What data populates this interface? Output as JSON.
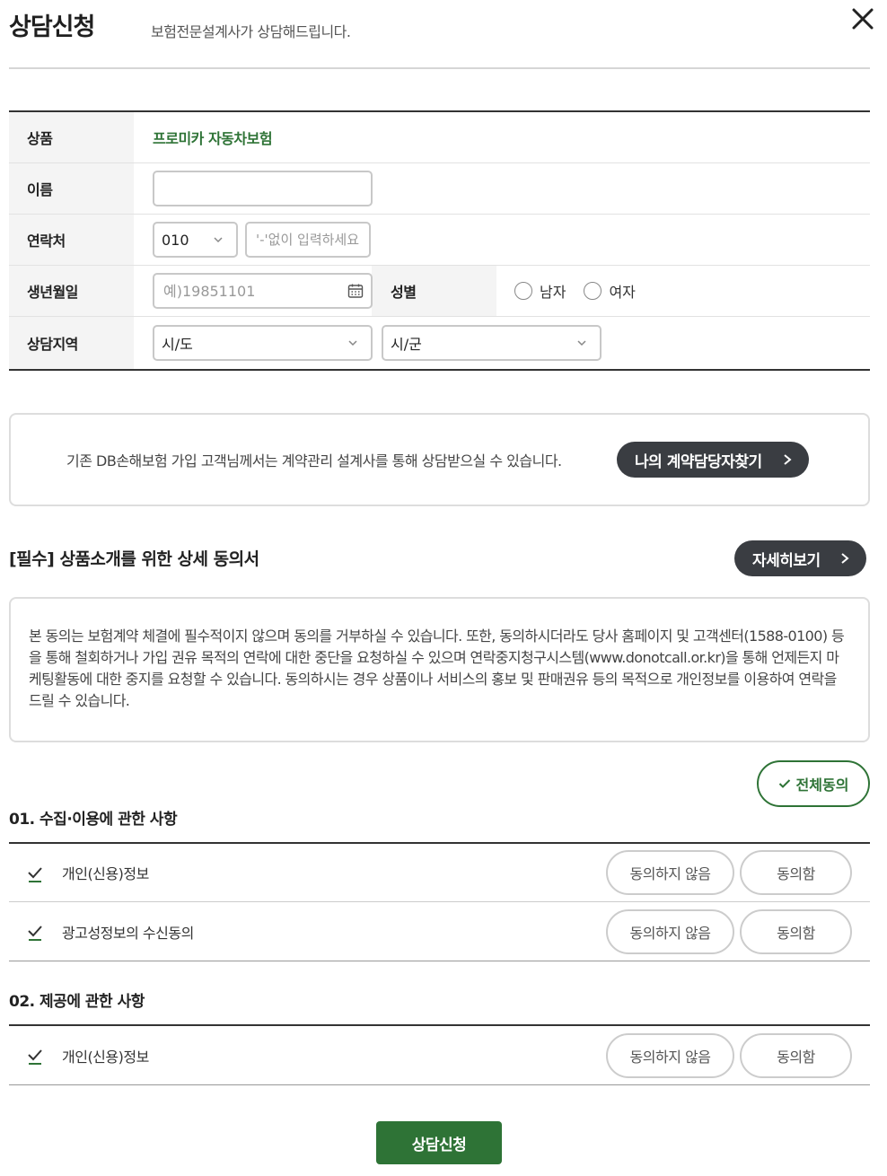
{
  "header": {
    "title": "상담신청",
    "subtitle": "보험전문설계사가 상담해드립니다."
  },
  "form": {
    "product_label": "상품",
    "product_value": "프로미카 자동차보험",
    "name_label": "이름",
    "name_value": "",
    "contact_label": "연락처",
    "phone_prefix": "010",
    "phone_placeholder": "'-'없이 입력하세요",
    "birth_label": "생년월일",
    "birth_placeholder": "예)19851101",
    "gender_label": "성별",
    "gender_options": [
      "남자",
      "여자"
    ],
    "region_label": "상담지역",
    "region_city": "시/도",
    "region_district": "시/군"
  },
  "info": {
    "text": "기존 DB손해보험 가입 고객님께서는 계약관리 설계사를 통해 상담받으실 수 있습니다.",
    "button": "나의 계약담당자찾기"
  },
  "consent": {
    "title": "[필수] 상품소개를 위한 상세 동의서",
    "detail_button": "자세히보기",
    "body": "본 동의는 보험계약 체결에 필수적이지 않으며 동의를 거부하실 수 있습니다. 또한, 동의하시더라도 당사 홈페이지 및 고객센터(1588-0100) 등을 통해 철회하거나 가입 권유 목적의 연락에 대한 중단을 요청하실 수 있으며 연락중지청구시스템(www.donotcall.or.kr)을 통해 언제든지 마케팅활동에 대한 중지를 요청할 수 있습니다. 동의하시는 경우 상품이나 서비스의 홍보 및 판매권유 등의 목적으로 개인정보를 이용하여 연락을 드릴 수 있습니다.",
    "all_agree": "전체동의"
  },
  "sections": [
    {
      "title": "01. 수집·이용에 관한 사항",
      "items": [
        {
          "label": "개인(신용)정보",
          "no": "동의하지 않음",
          "yes": "동의함"
        },
        {
          "label": "광고성정보의 수신동의",
          "no": "동의하지 않음",
          "yes": "동의함"
        }
      ]
    },
    {
      "title": "02. 제공에 관한 사항",
      "items": [
        {
          "label": "개인(신용)정보",
          "no": "동의하지 않음",
          "yes": "동의함"
        }
      ]
    }
  ],
  "submit_label": "상담신청",
  "colors": {
    "brand_green": "#2e7336",
    "dark_pill": "#3a3d42"
  }
}
